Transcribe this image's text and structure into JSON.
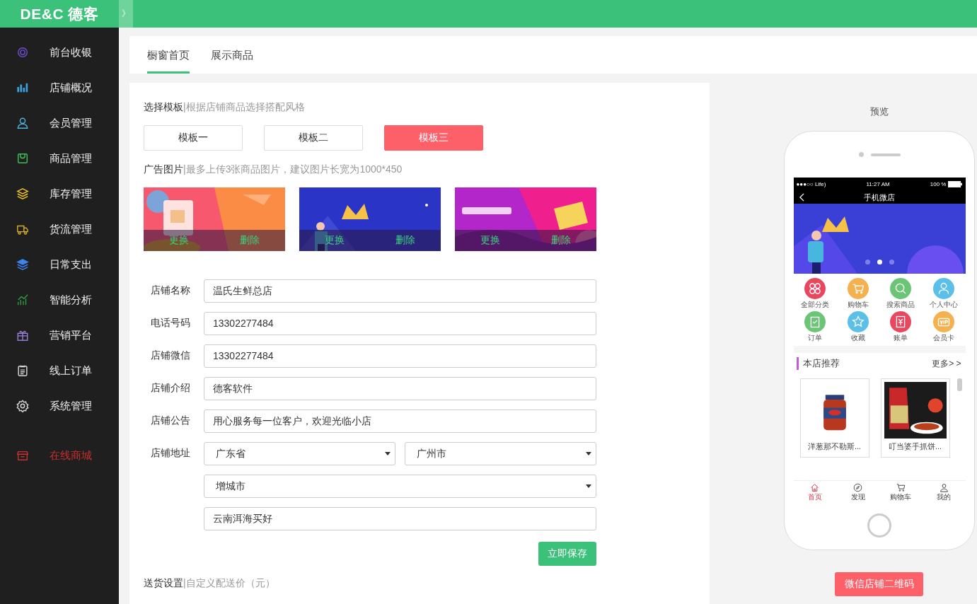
{
  "logo": "DE&C 德客",
  "collapse": "》",
  "sidebar": {
    "items": [
      {
        "label": "前台收银",
        "color": "#6a4fc9",
        "kind": "menu"
      },
      {
        "label": "店铺概况",
        "color": "#3ba0d8",
        "kind": "menu"
      },
      {
        "label": "会员管理",
        "color": "#4ab6d8",
        "kind": "menu"
      },
      {
        "label": "商品管理",
        "color": "#3bc15a",
        "kind": "menu"
      },
      {
        "label": "库存管理",
        "color": "#f2c424",
        "kind": "menu"
      },
      {
        "label": "货流管理",
        "color": "#d6a92a",
        "kind": "menu"
      },
      {
        "label": "日常支出",
        "color": "#3d82f0",
        "kind": "menu"
      },
      {
        "label": "智能分析",
        "color": "#2f9a3c",
        "kind": "menu"
      },
      {
        "label": "营销平台",
        "color": "#9a7fd6",
        "kind": "menu"
      },
      {
        "label": "线上订单",
        "color": "#d8d8d8",
        "kind": "menu"
      },
      {
        "label": "系统管理",
        "color": "#d8d8d8",
        "kind": "menu"
      },
      {
        "label": "在线商城",
        "color": "#c8302e",
        "kind": "shop"
      }
    ]
  },
  "tabs": [
    {
      "label": "橱窗首页",
      "selected": true
    },
    {
      "label": "展示商品",
      "selected": false
    }
  ],
  "template": {
    "title": "选择模板",
    "hint": "|根据店铺商品选择搭配风格",
    "options": [
      {
        "label": "模板一",
        "selected": false
      },
      {
        "label": "模板二",
        "selected": false
      },
      {
        "label": "模板三",
        "selected": true
      }
    ]
  },
  "ads": {
    "title": "广告图片",
    "hint": "|最多上传3张商品图片，建议图片长宽为1000*450",
    "images": [
      {
        "kind": "picture",
        "change": "更换",
        "delete": "删除"
      },
      {
        "kind": "picture",
        "change": "更换",
        "delete": "删除"
      },
      {
        "kind": "picture",
        "change": "更换",
        "delete": "删除"
      }
    ]
  },
  "form": {
    "rows": [
      {
        "label": "店铺名称",
        "controls": [
          {
            "kind": "input",
            "value": "温氏生鲜总店"
          }
        ]
      },
      {
        "label": "电话号码",
        "controls": [
          {
            "kind": "input",
            "value": "13302277484"
          }
        ]
      },
      {
        "label": "店铺微信",
        "controls": [
          {
            "kind": "input",
            "value": "13302277484"
          }
        ]
      },
      {
        "label": "店铺介绍",
        "controls": [
          {
            "kind": "input",
            "value": "德客软件"
          }
        ]
      },
      {
        "label": "店铺公告",
        "controls": [
          {
            "kind": "input",
            "value": "用心服务每一位客户，欢迎光临小店"
          }
        ]
      },
      {
        "label": "店铺地址",
        "controls": [
          {
            "kind": "select",
            "value": "广东省"
          },
          {
            "kind": "select",
            "value": "广州市"
          }
        ]
      },
      {
        "controls": [
          {
            "kind": "select",
            "value": "增城市"
          }
        ]
      },
      {
        "controls": [
          {
            "kind": "input",
            "value": "云南洱海买好"
          }
        ]
      }
    ],
    "save": "立即保存"
  },
  "delivery": {
    "title": "送货设置",
    "hint": "|自定义配送价（元）"
  },
  "preview": {
    "title": "预览",
    "phone": {
      "carrier": "●●●○○ Life)",
      "time": "11:27 AM",
      "battery": "100 %",
      "title": "手机微店",
      "banner_dots": [
        {
          "selected": false
        },
        {
          "selected": true
        },
        {
          "selected": false
        }
      ],
      "grid": [
        {
          "label": "全部分类",
          "color": "#e8475f"
        },
        {
          "label": "购物车",
          "color": "#f5b150"
        },
        {
          "label": "搜索商品",
          "color": "#6cc576"
        },
        {
          "label": "个人中心",
          "color": "#5bbfe8"
        },
        {
          "label": "订单",
          "color": "#6cc576"
        },
        {
          "label": "收藏",
          "color": "#5bbfe8"
        },
        {
          "label": "账单",
          "color": "#e8475f"
        },
        {
          "label": "会员卡",
          "color": "#f5b150"
        }
      ],
      "section": "本店推荐",
      "more": "更多> >",
      "products": [
        {
          "name": "洋葱那不勒斯..."
        },
        {
          "name": "叮当婆手抓饼..."
        }
      ],
      "tabbar": [
        {
          "label": "首页",
          "selected": true
        },
        {
          "label": "发现",
          "selected": false
        },
        {
          "label": "购物车",
          "selected": false
        },
        {
          "label": "我的",
          "selected": false
        }
      ]
    },
    "qr_button": "微信店铺二维码"
  }
}
